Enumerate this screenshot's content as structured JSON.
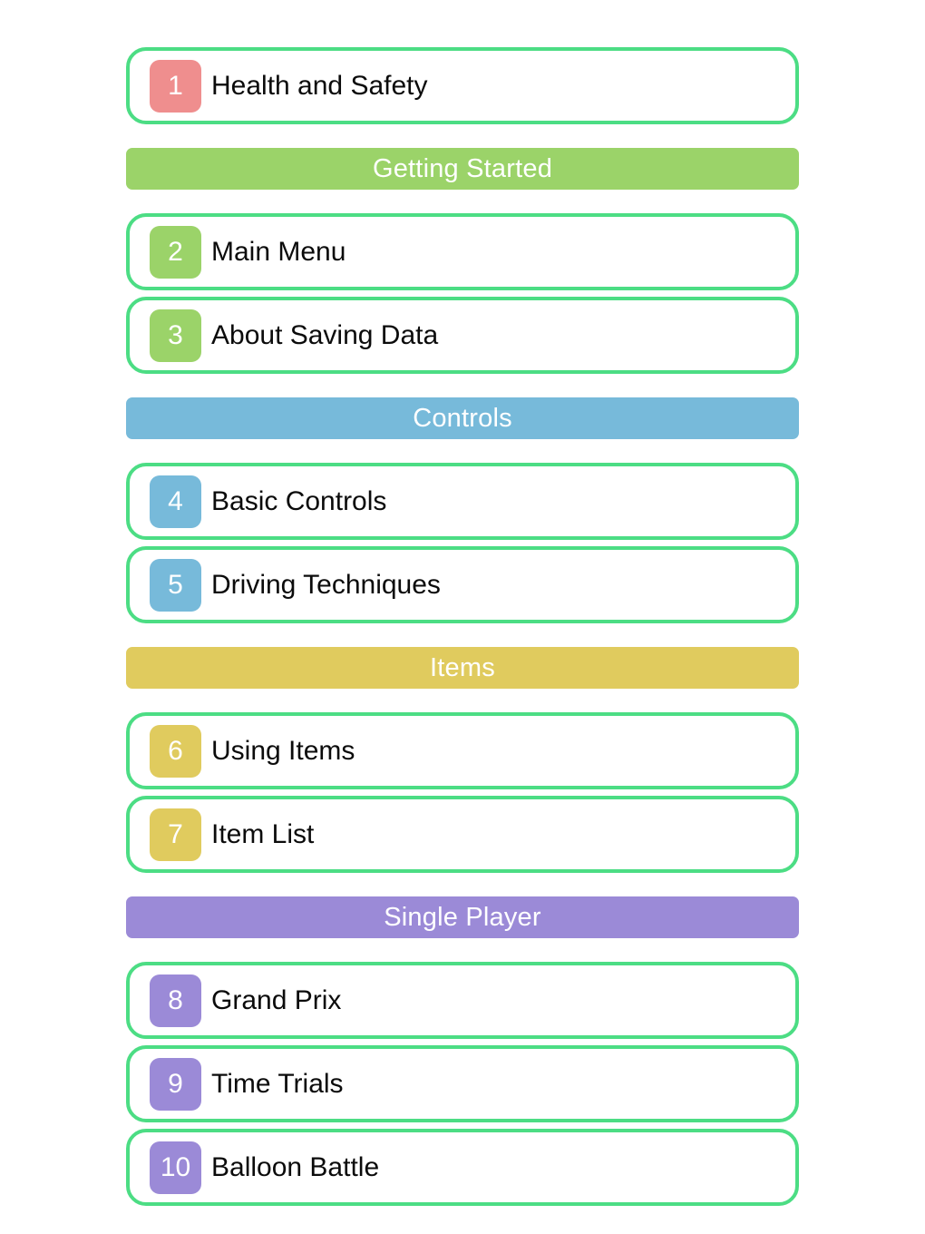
{
  "page": {
    "title": "Manual Table of Contents",
    "background_color": "#ffffff",
    "card_border_color": "#4cdd84",
    "card_background_color": "#ffffff",
    "entry_title_color": "#0b0b0b",
    "header_label_color": "#ffffff"
  },
  "groups": [
    {
      "id": "group-safety",
      "has_header": false,
      "header": null,
      "color": "#ef8e8e",
      "entries": [
        {
          "number": "1",
          "label": "Health and Safety",
          "badge_color": "#ef8e8e"
        }
      ]
    },
    {
      "id": "group-getting-started",
      "has_header": true,
      "header": "Getting Started",
      "color": "#9bd369",
      "entries": [
        {
          "number": "2",
          "label": "Main Menu",
          "badge_color": "#9bd369"
        },
        {
          "number": "3",
          "label": "About Saving Data",
          "badge_color": "#9bd369"
        }
      ]
    },
    {
      "id": "group-controls",
      "has_header": true,
      "header": "Controls",
      "color": "#77bada",
      "entries": [
        {
          "number": "4",
          "label": "Basic Controls",
          "badge_color": "#77bada"
        },
        {
          "number": "5",
          "label": "Driving Techniques",
          "badge_color": "#77bada"
        }
      ]
    },
    {
      "id": "group-items",
      "has_header": true,
      "header": "Items",
      "color": "#e0cb5e",
      "entries": [
        {
          "number": "6",
          "label": "Using Items",
          "badge_color": "#e0cb5e"
        },
        {
          "number": "7",
          "label": "Item List",
          "badge_color": "#e0cb5e"
        }
      ]
    },
    {
      "id": "group-single-player",
      "has_header": true,
      "header": "Single Player",
      "color": "#9b8ad7",
      "entries": [
        {
          "number": "8",
          "label": "Grand Prix",
          "badge_color": "#9b8ad7"
        },
        {
          "number": "9",
          "label": "Time Trials",
          "badge_color": "#9b8ad7"
        },
        {
          "number": "10",
          "label": "Balloon Battle",
          "badge_color": "#9b8ad7"
        }
      ]
    }
  ]
}
